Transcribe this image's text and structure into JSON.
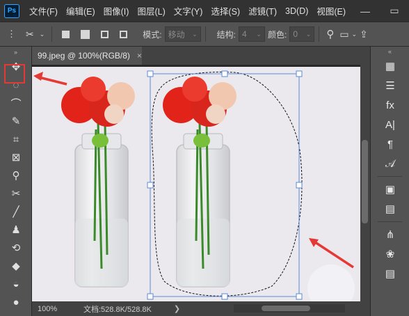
{
  "app": {
    "logo": "Ps",
    "menus": [
      "文件(F)",
      "编辑(E)",
      "图像(I)",
      "图层(L)",
      "文字(Y)",
      "选择(S)",
      "滤镜(T)",
      "3D(D)",
      "视图(E)"
    ],
    "window_controls": {
      "minimize": "—",
      "maximize": "▭"
    }
  },
  "options_bar": {
    "mode_label": "模式:",
    "mode_value": "移动",
    "structure_label": "结构:",
    "structure_value": "4",
    "color_label": "颜色:",
    "color_value": "0"
  },
  "document": {
    "tab_title": "99.jpeg @ 100%(RGB/8)",
    "tab_close": "×"
  },
  "status": {
    "zoom": "100%",
    "doc_info": "文档:528.8K/528.8K",
    "arrow": "❯"
  },
  "toolbar": {
    "collapse": "»",
    "tools": [
      {
        "name": "move-tool",
        "glyph": "✥"
      },
      {
        "name": "marquee-tool",
        "glyph": "◌"
      },
      {
        "name": "lasso-tool",
        "glyph": "⌒"
      },
      {
        "name": "quick-select-tool",
        "glyph": "✎"
      },
      {
        "name": "crop-tool",
        "glyph": "⌗"
      },
      {
        "name": "frame-tool",
        "glyph": "⊠"
      },
      {
        "name": "eyedropper-tool",
        "glyph": "⚲"
      },
      {
        "name": "content-aware-move-tool",
        "glyph": "✂"
      },
      {
        "name": "brush-tool",
        "glyph": "╱"
      },
      {
        "name": "stamp-tool",
        "glyph": "♟"
      },
      {
        "name": "history-brush-tool",
        "glyph": "⟲"
      },
      {
        "name": "eraser-tool",
        "glyph": "◆"
      },
      {
        "name": "paint-bucket-tool",
        "glyph": "◒"
      },
      {
        "name": "blur-tool",
        "glyph": "●"
      }
    ]
  },
  "right_panel": {
    "collapse": "«",
    "icons": [
      {
        "name": "history-icon",
        "glyph": "▦"
      },
      {
        "name": "adjustments-icon",
        "glyph": "☰"
      },
      {
        "name": "fx-icon",
        "glyph": "fx"
      },
      {
        "name": "character-icon",
        "glyph": "A|"
      },
      {
        "name": "paragraph-icon",
        "glyph": "¶"
      },
      {
        "name": "glyphs-icon",
        "glyph": "𝒜"
      },
      {
        "name": "gradient-icon",
        "glyph": "▣"
      },
      {
        "name": "libraries-icon",
        "glyph": "▤"
      },
      {
        "name": "paths-icon",
        "glyph": "⋔"
      },
      {
        "name": "channels-icon",
        "glyph": "❀"
      },
      {
        "name": "layers-icon",
        "glyph": "▤"
      }
    ]
  },
  "colors": {
    "annotation_red": "#e53935",
    "selection_handle": "#5a8ad6",
    "background": "#ebe9ee"
  }
}
